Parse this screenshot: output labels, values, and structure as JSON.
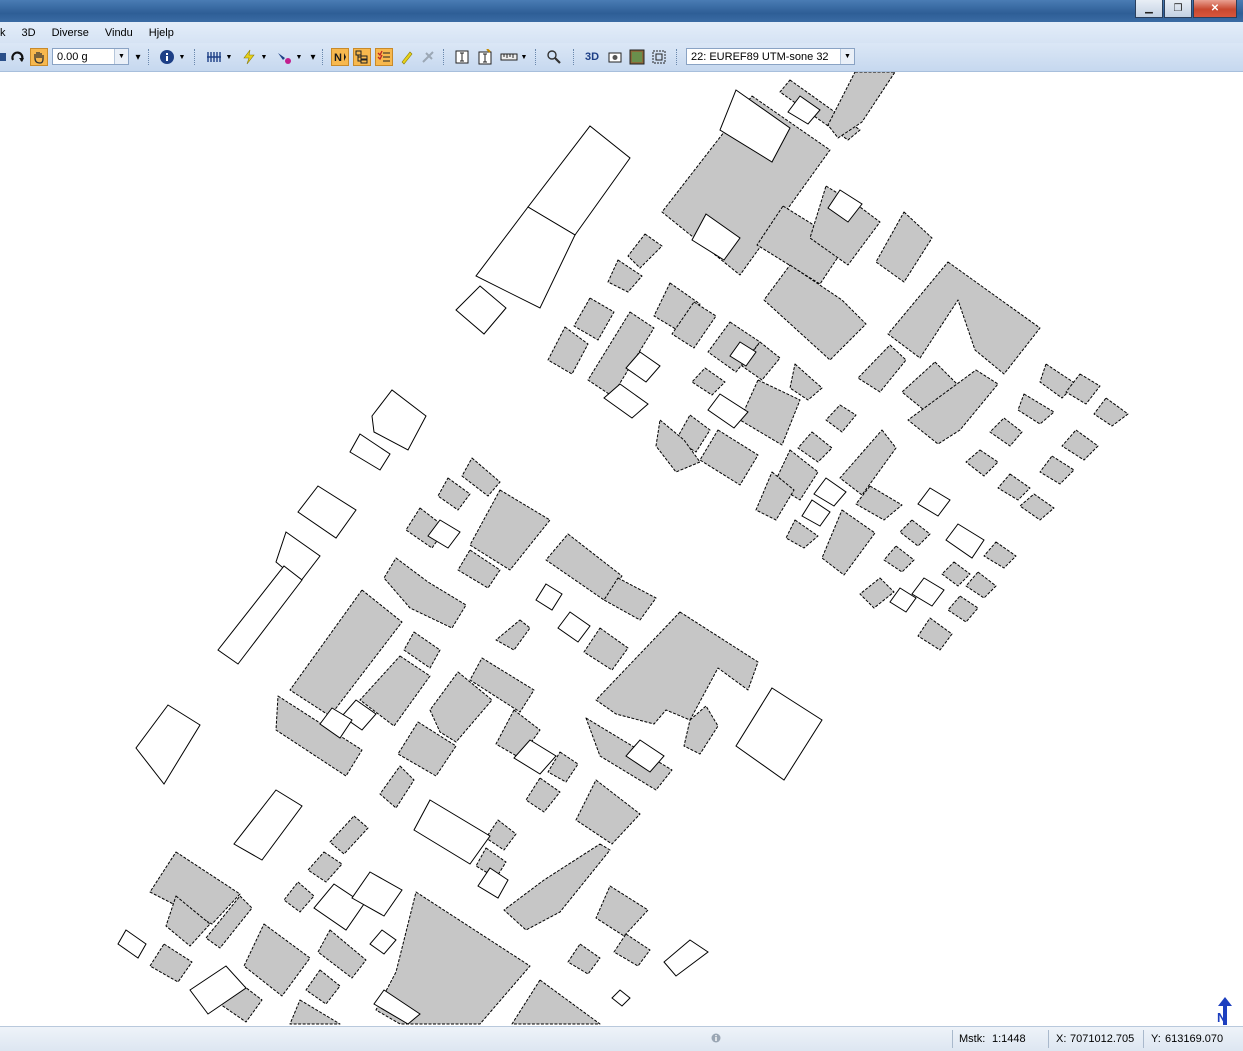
{
  "window": {
    "buttons": {
      "minimize": "▁",
      "maximize": "❐",
      "close": "✕"
    }
  },
  "menu": {
    "items": [
      "k",
      "3D",
      "Diverse",
      "Vindu",
      "Hjelp"
    ]
  },
  "toolbar": {
    "orientation_value": "0.00 g",
    "mode_3d_label": "3D",
    "coordinate_system": "22: EUREF89 UTM-sone 32",
    "icons": [
      "rotate-icon",
      "pan-hand-icon",
      "info-icon",
      "grid-icon",
      "lightning-icon",
      "paint-icon",
      "north-arrow-toggle-icon",
      "layers-icon",
      "list-icon",
      "highlight-icon",
      "snap-icon",
      "text-icon",
      "label-icon",
      "ruler-icon",
      "zoom-icon",
      "3d-icon",
      "camera-icon",
      "image-icon",
      "zoom-extent-icon"
    ]
  },
  "map": {
    "building_fill": "#c6c6c6",
    "outline_fill": "#ffffff",
    "edge_color": "#000000"
  },
  "statusbar": {
    "scale_label": "Mstk:",
    "scale_value": "1:1448",
    "x_label": "X:",
    "x_value": "7071012.705",
    "y_label": "Y:",
    "y_value": "613169.070"
  }
}
